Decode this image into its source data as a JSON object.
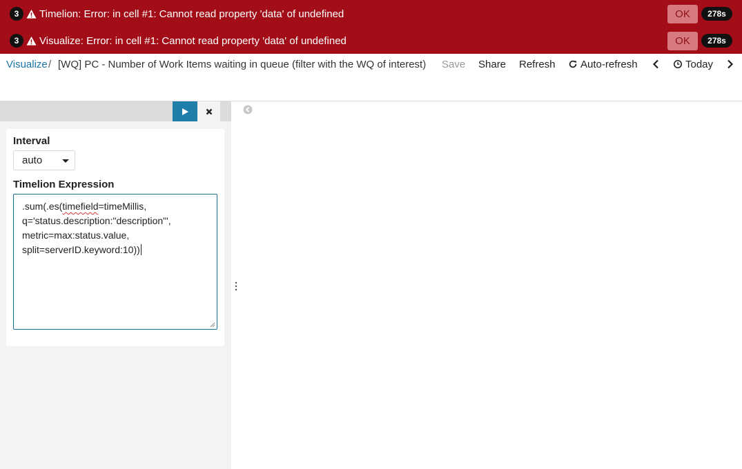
{
  "toasts": [
    {
      "count": "3",
      "message": "Timelion: Error: in cell #1: Cannot read property 'data' of undefined",
      "ok_label": "OK",
      "time": "278s"
    },
    {
      "count": "3",
      "message": "Visualize: Error: in cell #1: Cannot read property 'data' of undefined",
      "ok_label": "OK",
      "time": "278s"
    }
  ],
  "breadcrumb": {
    "link": "Visualize",
    "separator": "/",
    "title": "[WQ] PC - Number of Work Items waiting in queue (filter with the WQ of interest)"
  },
  "nav": {
    "save": "Save",
    "share": "Share",
    "refresh": "Refresh",
    "auto_refresh": "Auto-refresh",
    "today": "Today"
  },
  "editor": {
    "interval_label": "Interval",
    "interval_value": "auto",
    "expression_label": "Timelion Expression",
    "expression_lines": [
      ".sum(.es(",
      "timefield",
      "=timeMillis,",
      "q='status.description:\"description\"',",
      "metric=max:status.value,",
      "split=serverID.keyword:10))"
    ]
  },
  "colors": {
    "error_bg": "#a30d18",
    "ok_bg": "#d77a7f",
    "link": "#1a74a6",
    "run_button": "#1f7eaa",
    "focus_border": "#1a6f9a"
  },
  "icons": [
    "warning-icon",
    "play-icon",
    "close-icon",
    "refresh-icon",
    "clock-icon",
    "chevron-left-icon",
    "chevron-right-icon",
    "collapse-circle-icon",
    "vertical-dots-icon"
  ]
}
